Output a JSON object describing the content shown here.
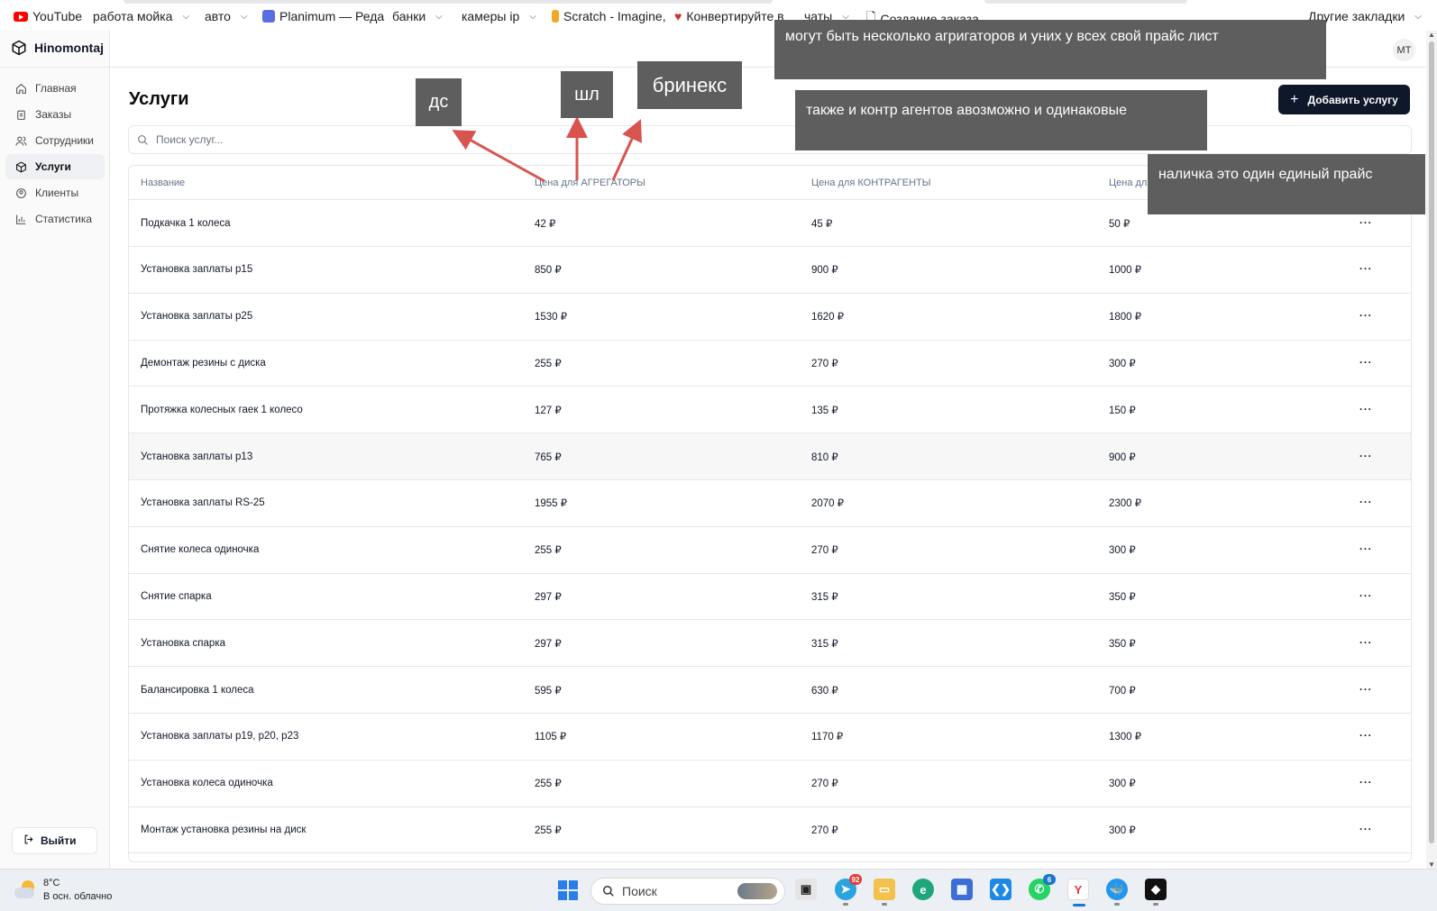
{
  "bookmarks": [
    {
      "label": "YouTube",
      "icon": "youtube-icon"
    },
    {
      "label": "работа мойка",
      "dropdown": true
    },
    {
      "label": "авто",
      "dropdown": true
    },
    {
      "label": "Planimum — Реда",
      "icon": "planimum-icon"
    },
    {
      "label": "банки",
      "dropdown": true
    },
    {
      "label": "камеры ip",
      "dropdown": true
    },
    {
      "label": "Scratch - Imagine,",
      "icon": "scratch-icon"
    },
    {
      "label": "Конвертируйте в",
      "icon": "heart-icon"
    },
    {
      "label": "чаты",
      "dropdown": true
    },
    {
      "label": "Создание заказа",
      "icon": "document-icon"
    },
    {
      "label": "Другие закладки",
      "dropdown": true
    }
  ],
  "app": {
    "brand": "Hinomontaj",
    "avatar": "MT",
    "nav": [
      {
        "label": "Главная",
        "icon": "home-icon"
      },
      {
        "label": "Заказы",
        "icon": "clipboard-icon"
      },
      {
        "label": "Сотрудники",
        "icon": "users-icon"
      },
      {
        "label": "Услуги",
        "icon": "package-icon",
        "active": true
      },
      {
        "label": "Клиенты",
        "icon": "user-circle-icon"
      },
      {
        "label": "Статистика",
        "icon": "bar-chart-icon"
      }
    ],
    "logout": "Выйти"
  },
  "page": {
    "title": "Услуги",
    "add_button": "Добавить услугу",
    "search_placeholder": "Поиск услуг..."
  },
  "table": {
    "columns": [
      "Название",
      "Цена для АГРЕГАТОРЫ",
      "Цена для КОНТРАГЕНТЫ",
      "Цена для НАЛИЧКА"
    ],
    "actions_glyph": "···",
    "rows": [
      [
        "Подкачка 1 колеса",
        "42 ₽",
        "45 ₽",
        "50 ₽"
      ],
      [
        "Установка заплаты р15",
        "850 ₽",
        "900 ₽",
        "1000 ₽"
      ],
      [
        "Установка заплаты р25",
        "1530 ₽",
        "1620 ₽",
        "1800 ₽"
      ],
      [
        "Демонтаж резины с диска",
        "255 ₽",
        "270 ₽",
        "300 ₽"
      ],
      [
        "Протяжка колесных гаек 1 колесо",
        "127 ₽",
        "135 ₽",
        "150 ₽"
      ],
      [
        "Установка заплаты р13",
        "765 ₽",
        "810 ₽",
        "900 ₽"
      ],
      [
        "Установка заплаты RS-25",
        "1955 ₽",
        "2070 ₽",
        "2300 ₽"
      ],
      [
        "Снятие колеса одиночка",
        "255 ₽",
        "270 ₽",
        "300 ₽"
      ],
      [
        "Снятие спарка",
        "297 ₽",
        "315 ₽",
        "350 ₽"
      ],
      [
        "Установка спарка",
        "297 ₽",
        "315 ₽",
        "350 ₽"
      ],
      [
        "Балансировка 1 колеса",
        "595 ₽",
        "630 ₽",
        "700 ₽"
      ],
      [
        "Установка заплаты р19, р20, р23",
        "1105 ₽",
        "1170 ₽",
        "1300 ₽"
      ],
      [
        "Установка колеса одиночка",
        "255 ₽",
        "270 ₽",
        "300 ₽"
      ],
      [
        "Монтаж установка резины на диск",
        "255 ₽",
        "270 ₽",
        "300 ₽"
      ]
    ]
  },
  "annotations": {
    "ds": "дс",
    "shl": "шл",
    "brinex": "бринекс",
    "note_aggregators": "могут быть несколько агригаторов и уних у всех свой прайс лист",
    "note_counterparties": "также и контр агентов авозможно и одинаковые",
    "note_cash": "наличка это один единый прайс",
    "arrow_color": "#d9534f"
  },
  "taskbar": {
    "temperature": "8°C",
    "weather": "В осн. облачно",
    "search_label": "Поиск",
    "telegram_badge": "92",
    "whatsapp_badge": "6"
  }
}
